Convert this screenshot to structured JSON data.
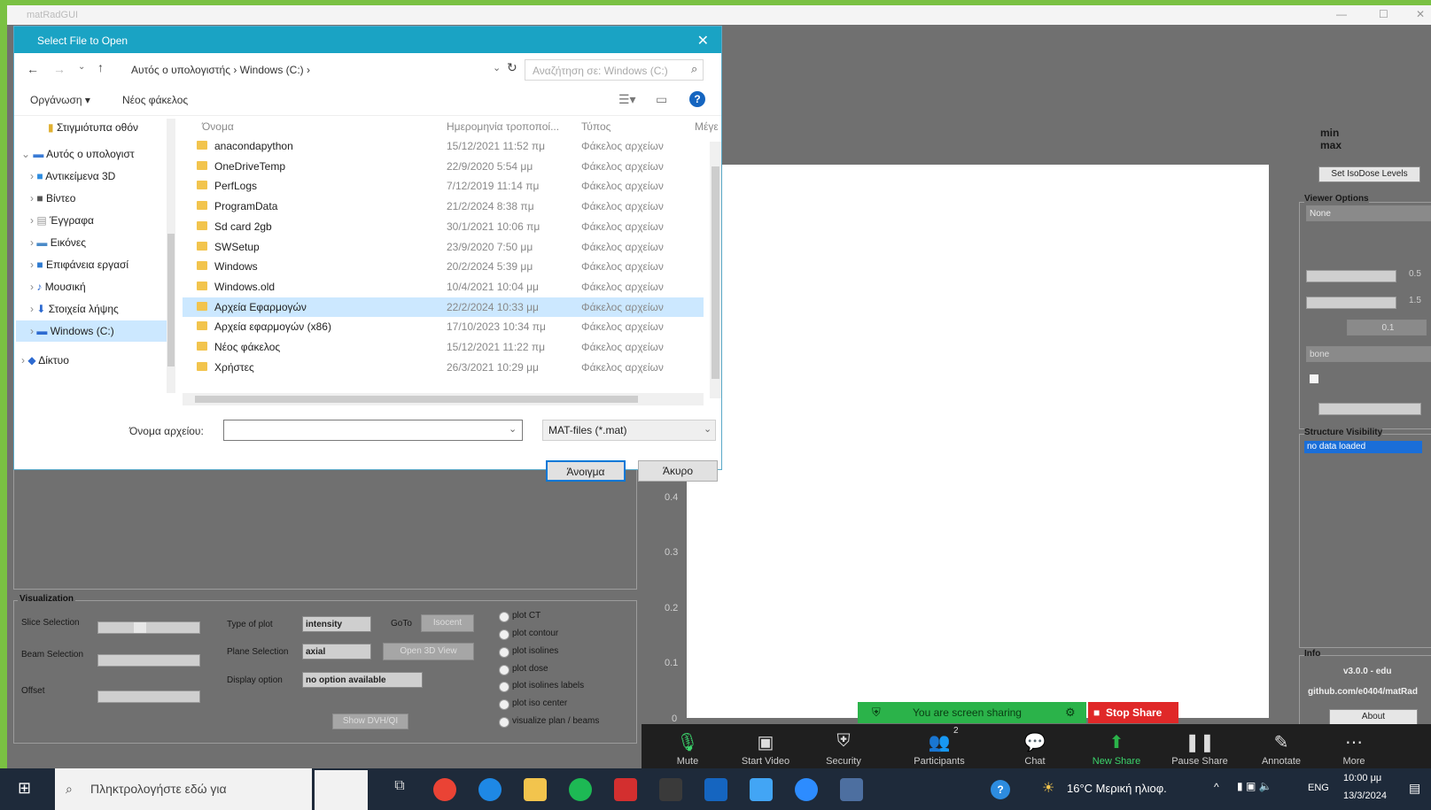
{
  "app": {
    "title": "matRadGUI"
  },
  "dialog": {
    "title": "Select File to Open",
    "breadcrumb": "Αυτός ο υπολογιστής  ›  Windows (C:)  ›",
    "search_placeholder": "Αναζήτηση σε: Windows (C:)",
    "organize": "Οργάνωση ▾",
    "new_folder": "Νέος φάκελος",
    "nav": [
      "Στιγμιότυπα οθόν",
      "Αυτός ο υπολογιστ",
      "Αντικείμενα 3D",
      "Βίντεο",
      "Έγγραφα",
      "Εικόνες",
      "Επιφάνεια εργασί",
      "Μουσική",
      "Στοιχεία λήψης",
      "Windows (C:)",
      "Δίκτυο"
    ],
    "columns": {
      "name": "Όνομα",
      "date": "Ημερομηνία τροποποί...",
      "type": "Τύπος",
      "size": "Μέγε"
    },
    "files": [
      {
        "name": "anacondapython",
        "date": "15/12/2021 11:52 πμ",
        "type": "Φάκελος αρχείων"
      },
      {
        "name": "OneDriveTemp",
        "date": "22/9/2020 5:54 μμ",
        "type": "Φάκελος αρχείων"
      },
      {
        "name": "PerfLogs",
        "date": "7/12/2019 11:14 πμ",
        "type": "Φάκελος αρχείων"
      },
      {
        "name": "ProgramData",
        "date": "21/2/2024 8:38 πμ",
        "type": "Φάκελος αρχείων"
      },
      {
        "name": "Sd card 2gb",
        "date": "30/1/2021 10:06 πμ",
        "type": "Φάκελος αρχείων"
      },
      {
        "name": "SWSetup",
        "date": "23/9/2020 7:50 μμ",
        "type": "Φάκελος αρχείων"
      },
      {
        "name": "Windows",
        "date": "20/2/2024 5:39 μμ",
        "type": "Φάκελος αρχείων"
      },
      {
        "name": "Windows.old",
        "date": "10/4/2021 10:04 μμ",
        "type": "Φάκελος αρχείων"
      },
      {
        "name": "Αρχεία Εφαρμογών",
        "date": "22/2/2024 10:33 μμ",
        "type": "Φάκελος αρχείων",
        "selected": true
      },
      {
        "name": "Αρχεία εφαρμογών (x86)",
        "date": "17/10/2023 10:34 πμ",
        "type": "Φάκελος αρχείων"
      },
      {
        "name": "Νέος φάκελος",
        "date": "15/12/2021 11:22 πμ",
        "type": "Φάκελος αρχείων"
      },
      {
        "name": "Χρήστες",
        "date": "26/3/2021 10:29 μμ",
        "type": "Φάκελος αρχείων"
      }
    ],
    "filename_label": "Όνομα αρχείου:",
    "filename_value": "",
    "filter": "MAT-files (*.mat)",
    "open": "Άνοιγμα",
    "cancel": "Άκυρο"
  },
  "visualization": {
    "title": "Visualization",
    "slice_selection": "Slice Selection",
    "beam_selection": "Beam Selection",
    "offset": "Offset",
    "type_of_plot": "Type of plot",
    "type_value": "intensity",
    "goto": "GoTo",
    "goto_btn": "Isocent",
    "plane_selection": "Plane Selection",
    "plane_value": "axial",
    "open_3d": "Open 3D View",
    "display_option": "Display option",
    "display_value": "no option available",
    "show_dvh": "Show DVH/QI",
    "radios": [
      "plot CT",
      "plot contour",
      "plot isolines",
      "plot dose",
      "plot isolines labels",
      "plot iso center",
      "visualize plan / beams"
    ]
  },
  "plot": {
    "yticks": [
      "0.4",
      "0.3",
      "0.2",
      "0.1",
      "0"
    ]
  },
  "right": {
    "min": "min",
    "max": "max",
    "set_isodose": "Set IsoDose Levels",
    "viewer_options": "Viewer Options",
    "viewer_value": "None",
    "val1": "0.5",
    "val2": "1.5",
    "val3": "0.1",
    "bone": "bone",
    "structure_visibility": "Structure Visibility",
    "no_data": "no data loaded",
    "info": "Info",
    "version": "v3.0.0 - edu",
    "github": "github.com/e0404/matRad",
    "about": "About"
  },
  "zoom": {
    "sharing": "You are screen sharing",
    "stop_share": "Stop Share",
    "buttons": [
      "Mute",
      "Start Video",
      "Security",
      "Participants",
      "Chat",
      "New Share",
      "Pause Share",
      "Annotate",
      "More"
    ],
    "participants_count": "2"
  },
  "taskbar": {
    "search": "Πληκτρολογήστε εδώ για",
    "weather": "16°C  Μερική ηλιοφ.",
    "lang": "ENG",
    "time": "10:00 μμ",
    "date": "13/3/2024"
  }
}
